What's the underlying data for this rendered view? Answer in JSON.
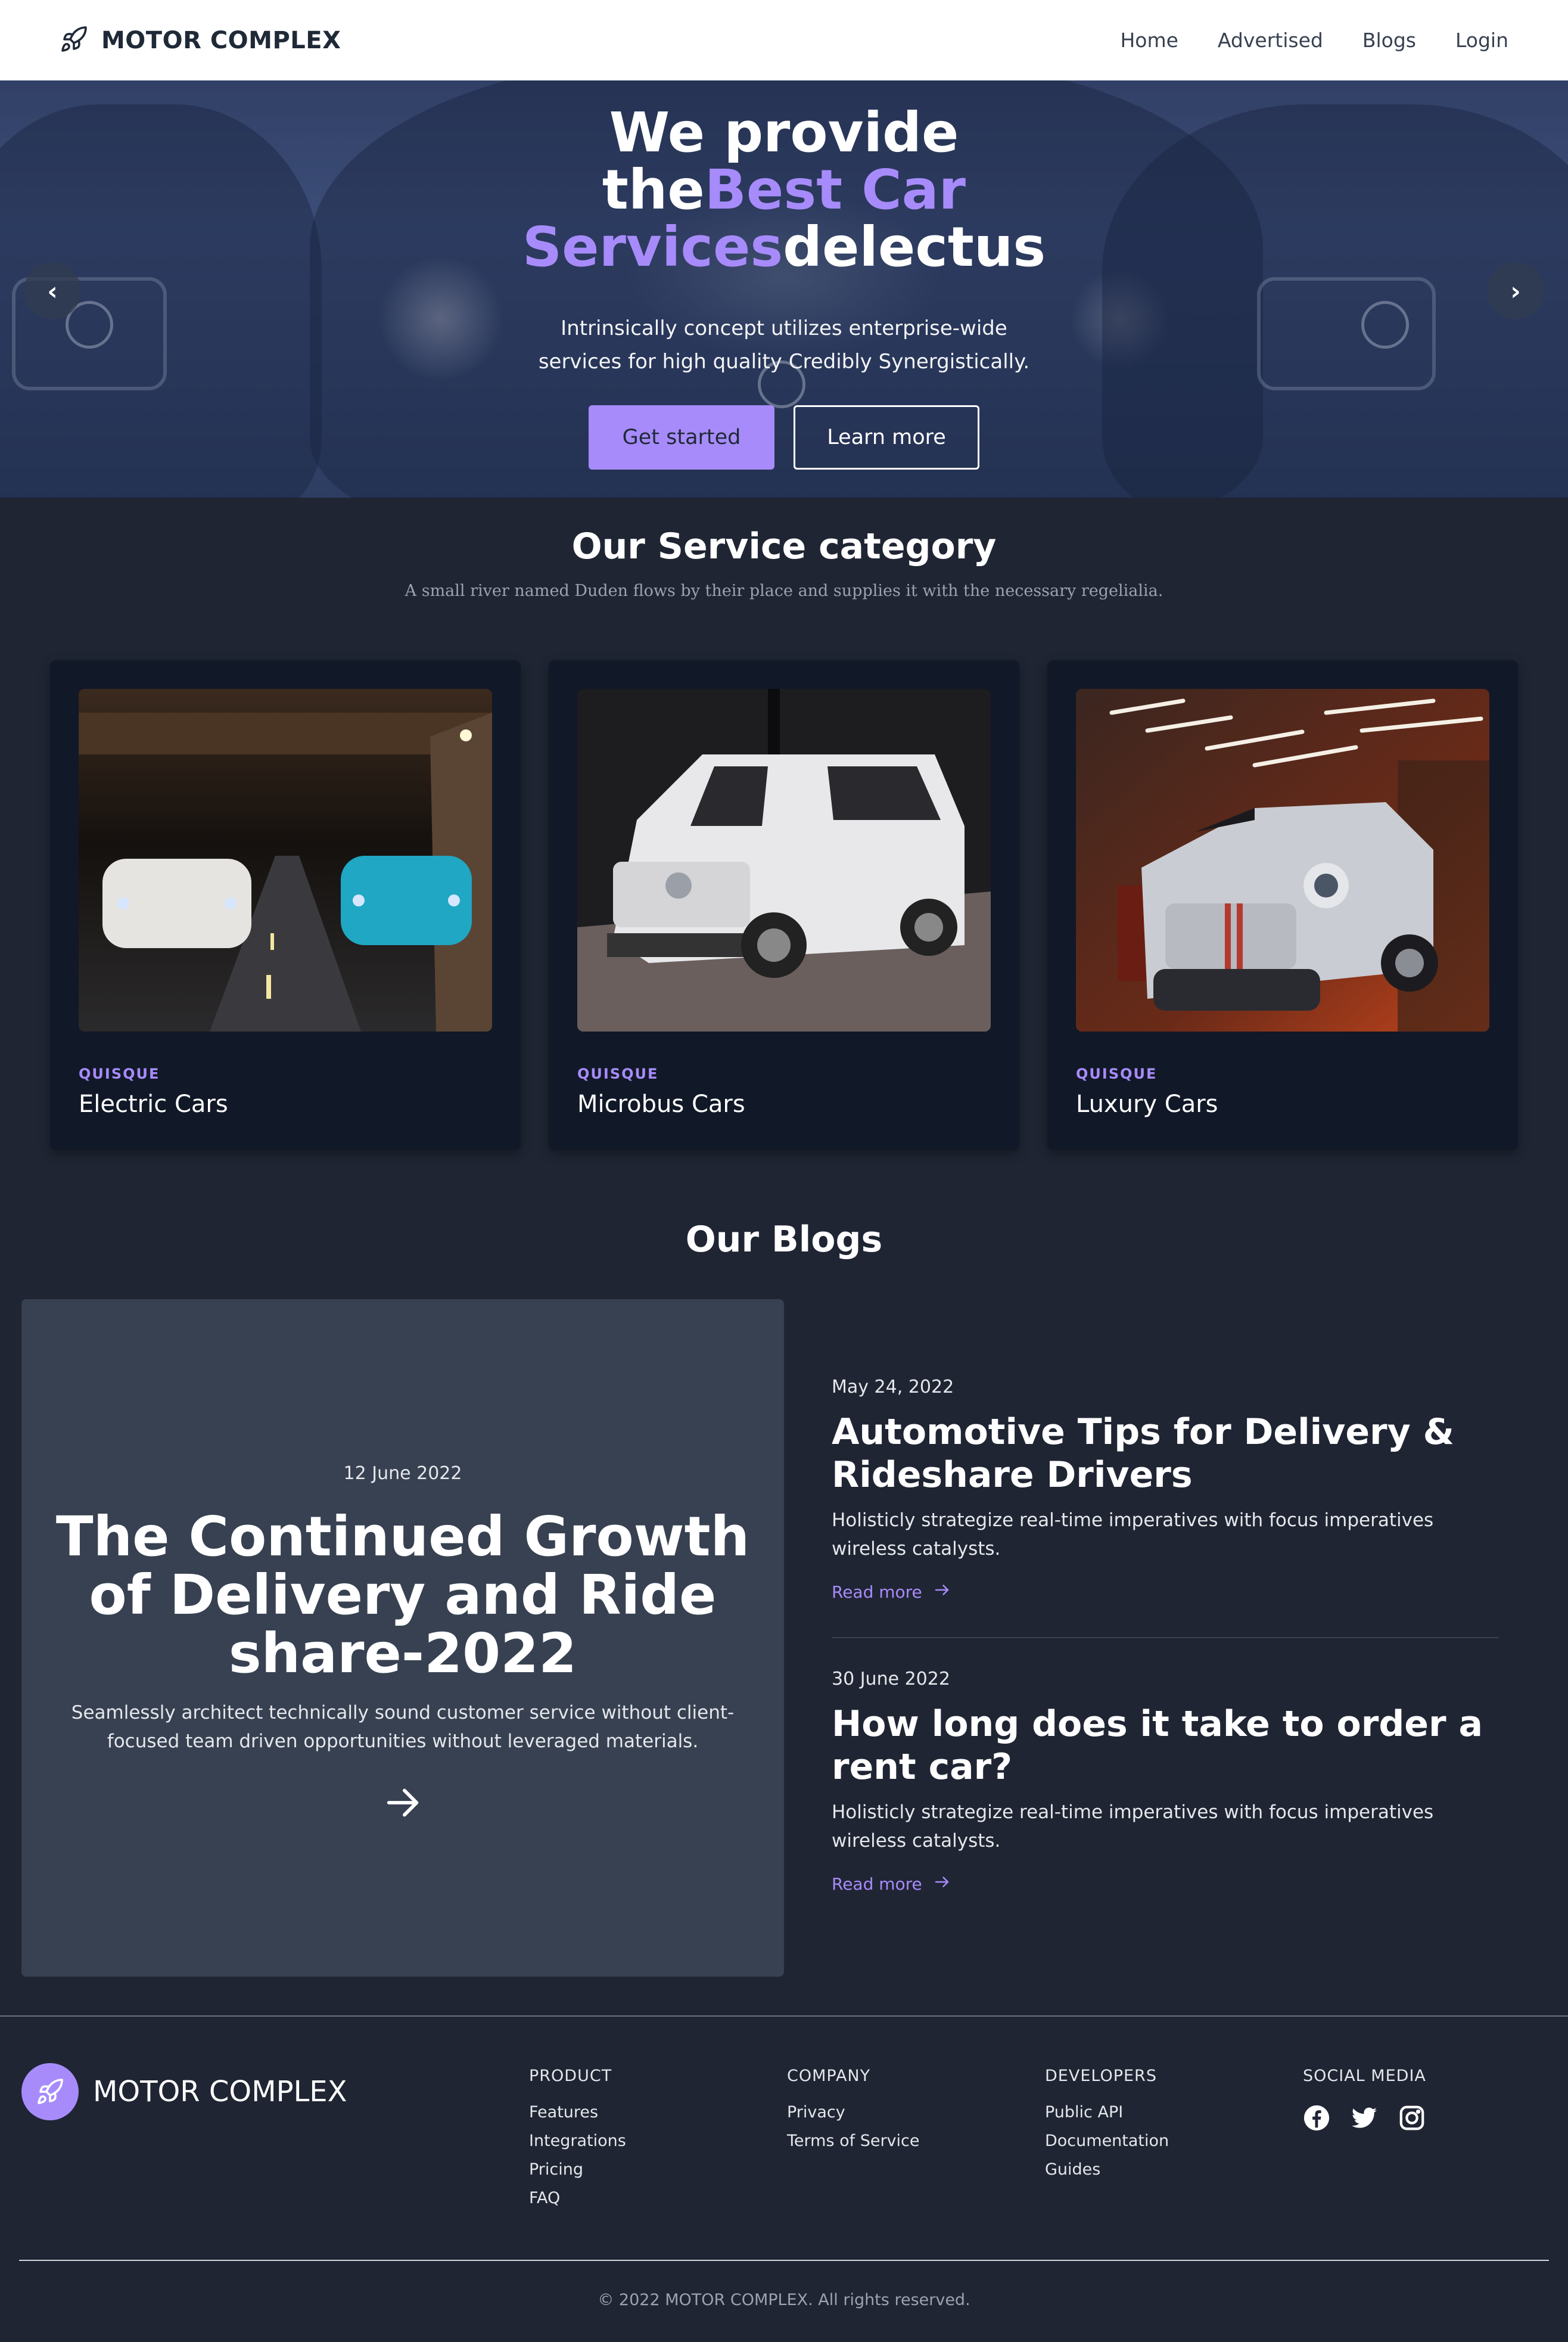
{
  "brand": {
    "name": "MOTOR COMPLEX",
    "accent": "#a78bfa"
  },
  "nav": {
    "links": [
      "Home",
      "Advertised",
      "Blogs",
      "Login"
    ]
  },
  "hero": {
    "title_part1": "We provide the",
    "title_highlight1": "Best Car Services",
    "title_part2": "delectus",
    "subtitle": "Intrinsically concept utilizes enterprise-wide services for high quality Credibly Synergistically.",
    "primary_button": "Get started",
    "secondary_button": "Learn more",
    "prev_icon": "chevron-left-icon",
    "next_icon": "chevron-right-icon"
  },
  "services": {
    "title": "Our Service category",
    "subtitle": "A small river named Duden flows by their place and supplies it with the necessary regelialia.",
    "cards": [
      {
        "kicker": "QUISQUE",
        "title": "Electric Cars"
      },
      {
        "kicker": "QUISQUE",
        "title": "Microbus Cars"
      },
      {
        "kicker": "QUISQUE",
        "title": "Luxury Cars"
      }
    ]
  },
  "blogs": {
    "title": "Our Blogs",
    "featured": {
      "date": "12 June 2022",
      "title": "The Continued Growth of Delivery and Ride share-2022",
      "description": "Seamlessly architect technically sound customer service without client-focused team driven opportunities without leveraged materials."
    },
    "posts": [
      {
        "date": "May 24, 2022",
        "title": "Automotive Tips for Delivery & Rideshare Drivers",
        "description": "Holisticly strategize real-time imperatives with focus imperatives wireless catalysts.",
        "link": "Read more"
      },
      {
        "date": "30 June 2022",
        "title": "How long does it take to order a rent car?",
        "description": "Holisticly strategize real-time imperatives with focus imperatives wireless catalysts.",
        "link": "Read more"
      }
    ]
  },
  "footer": {
    "brand": "MOTOR COMPLEX",
    "columns": [
      {
        "heading": "PRODUCT",
        "items": [
          "Features",
          "Integrations",
          "Pricing",
          "FAQ"
        ]
      },
      {
        "heading": "COMPANY",
        "items": [
          "Privacy",
          "Terms of Service"
        ]
      },
      {
        "heading": "DEVELOPERS",
        "items": [
          "Public API",
          "Documentation",
          "Guides"
        ]
      }
    ],
    "social_heading": "SOCIAL MEDIA",
    "social_icons": [
      "facebook-icon",
      "twitter-icon",
      "instagram-icon"
    ],
    "copyright": "© 2022 MOTOR COMPLEX. All rights reserved."
  }
}
